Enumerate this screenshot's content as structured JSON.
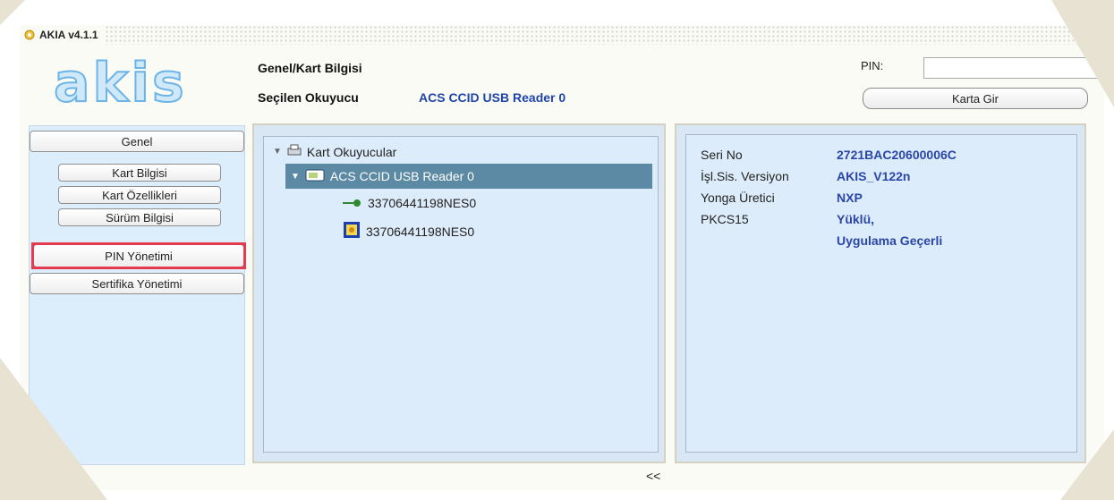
{
  "window": {
    "title": "AKIA v4.1.1"
  },
  "header": {
    "section_title": "Genel/Kart Bilgisi",
    "reader_label": "Seçilen Okuyucu",
    "reader_value": "ACS CCID USB Reader 0",
    "pin_label": "PIN:",
    "pin_value": "",
    "login_button": "Karta Gir"
  },
  "logo_text": "akis",
  "sidebar": {
    "group": "Genel",
    "items": [
      "Kart Bilgisi",
      "Kart Özellikleri",
      "Sürüm Bilgisi"
    ],
    "pin_management": "PIN Yönetimi",
    "cert_management": "Sertifika Yönetimi"
  },
  "tree": {
    "root": "Kart Okuyucular",
    "reader": "ACS CCID USB Reader 0",
    "items": [
      "33706441198NES0",
      "33706441198NES0"
    ]
  },
  "properties": [
    {
      "label": "Seri No",
      "value": "2721BAC20600006C"
    },
    {
      "label": "İşl.Sis. Versiyon",
      "value": "AKIS_V122n"
    },
    {
      "label": "Yonga Üretici",
      "value": "NXP"
    },
    {
      "label": "PKCS15",
      "value": "Yüklü,"
    },
    {
      "label": "",
      "value": "Uygulama Geçerli"
    }
  ],
  "collapse_label": "<<",
  "colors": {
    "accent": "#2a46a6",
    "highlight": "#e63a4e",
    "selection": "#5c8aa4"
  }
}
